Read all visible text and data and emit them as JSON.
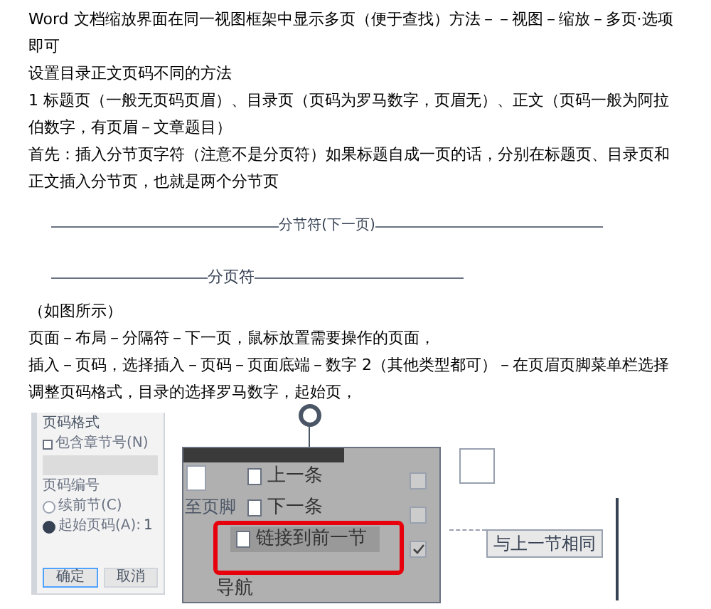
{
  "paragraphs": [
    "Word 文档缩放界面在同一视图框架中显示多页（便于查找）方法－－视图－缩放－多页·选项即可",
    "设置目录正文页码不同的方法",
    "1 标题页（一般无页码页眉）、目录页（页码为罗马数字，页眉无）、正文（页码一般为阿拉伯数字，有页眉－文章题目）",
    "首先：插入分节页字符（注意不是分页符）如果标题自成一页的话，分别在标题页、目录页和正文插入分节页，也就是两个分节页"
  ],
  "section_break": "分节符(下一页)",
  "page_break": "分页符",
  "paragraphs_after": [
    "（如图所示）",
    "页面－布局－分隔符－下一页，鼠标放置需要操作的页面，",
    "插入－页码，选择插入－页码－页面底端－数字 2（其他类型都可）－在页眉页脚菜单栏选择调整页码格式，目录的选择罗马数字，起始页，"
  ],
  "dialog": {
    "title": "页码格式",
    "include_chapter": {
      "label": "包含章节号(N)",
      "checked": false
    },
    "section_label": "页码编号",
    "radios": [
      {
        "label": "续前节(C)",
        "selected": false
      },
      {
        "label": "起始页码(A):",
        "selected": true
      }
    ],
    "start_value": "1",
    "buttons": [
      "确定",
      "取消"
    ]
  },
  "ribbon": {
    "items": [
      {
        "label": "上一条",
        "highlighted": false
      },
      {
        "label": "下一条",
        "highlighted": false
      },
      {
        "label": "链接到前一节",
        "highlighted": true
      }
    ],
    "side_label": "至页脚",
    "group_label": "导航",
    "checkboxes": [
      {
        "checked": false
      },
      {
        "checked": false
      },
      {
        "checked": true
      }
    ]
  },
  "footer_tag": "与上一节相同"
}
